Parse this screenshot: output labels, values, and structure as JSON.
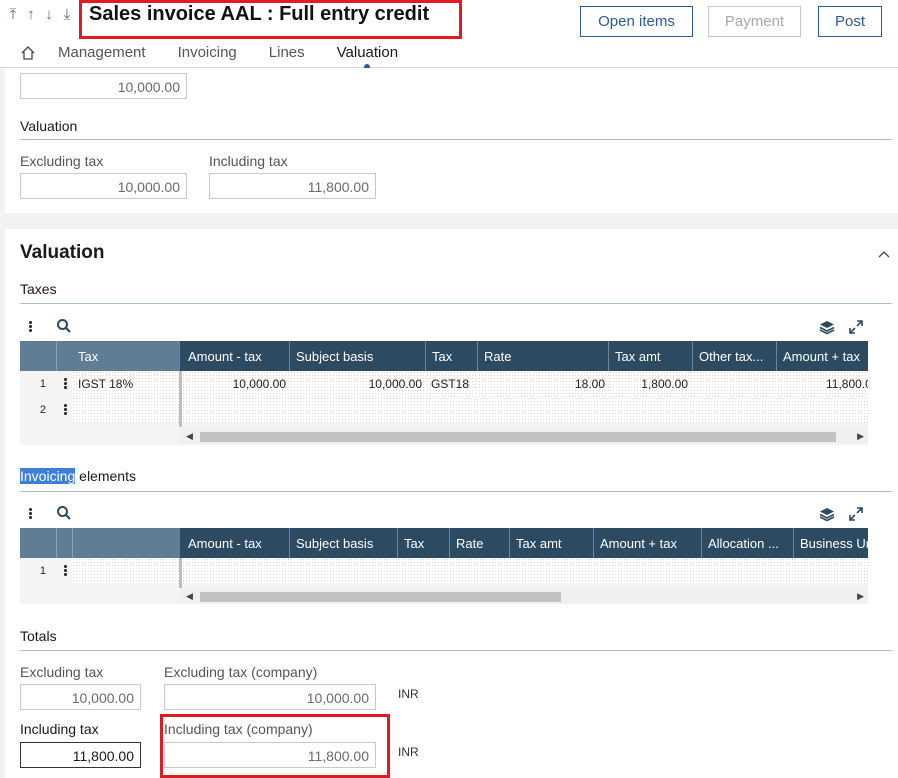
{
  "header": {
    "title": "Sales invoice AAL : Full entry credit",
    "buttons": {
      "open_items": "Open items",
      "payment": "Payment",
      "post": "Post"
    },
    "tabs": [
      "Management",
      "Invoicing",
      "Lines",
      "Valuation"
    ],
    "active_tab": "Valuation",
    "nav_icons": [
      "first-record-icon",
      "previous-record-icon",
      "next-record-icon",
      "last-record-icon"
    ]
  },
  "top_section": {
    "top_value": "10,000.00",
    "valuation_label": "Valuation",
    "excluding_tax_label": "Excluding tax",
    "excluding_tax_value": "10,000.00",
    "including_tax_label": "Including tax",
    "including_tax_value": "11,800.00"
  },
  "valuation": {
    "title": "Valuation",
    "taxes": {
      "label": "Taxes",
      "columns": [
        "Tax",
        "Amount - tax",
        "Subject basis",
        "Tax",
        "Rate",
        "Tax amt",
        "Other tax...",
        "Amount + tax"
      ],
      "rows": [
        {
          "num": "1",
          "tax": "IGST 18%",
          "amount_tax": "10,000.00",
          "subject_basis": "10,000.00",
          "tax_code": "GST18",
          "rate": "18.00",
          "tax_amt": "1,800.00",
          "other_tax": "",
          "amount_plus_tax": "11,800.0"
        },
        {
          "num": "2",
          "tax": "",
          "amount_tax": "",
          "subject_basis": "",
          "tax_code": "",
          "rate": "",
          "tax_amt": "",
          "other_tax": "",
          "amount_plus_tax": ""
        }
      ]
    },
    "invoicing_elements": {
      "label_highlight": "Invoicing",
      "label_rest": " elements",
      "columns": [
        "Amount - tax",
        "Subject basis",
        "Tax",
        "Rate",
        "Tax amt",
        "Amount + tax",
        "Allocation ...",
        "Business Un"
      ],
      "rows": [
        {
          "num": "1"
        }
      ]
    },
    "totals": {
      "label": "Totals",
      "excl_tax_label": "Excluding tax",
      "excl_tax_value": "10,000.00",
      "excl_tax_company_label": "Excluding tax (company)",
      "excl_tax_company_value": "10,000.00",
      "incl_tax_label": "Including tax",
      "incl_tax_value": "11,800.00",
      "incl_tax_company_label": "Including tax (company)",
      "incl_tax_company_value": "11,800.00",
      "currency": "INR"
    }
  },
  "colors": {
    "accent": "#2c5aa0",
    "grid_header": "#2c4a62",
    "annotation": "#e01b24"
  }
}
